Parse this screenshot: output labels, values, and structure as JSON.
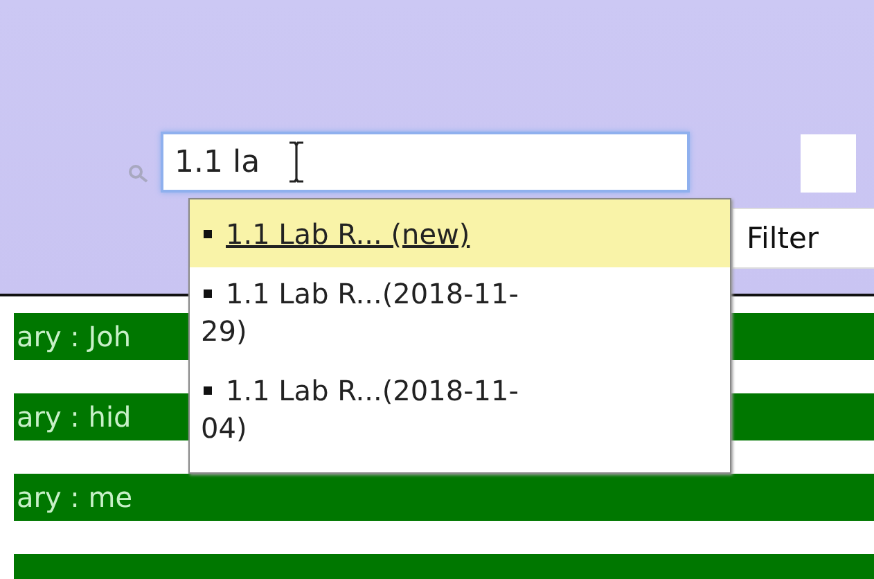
{
  "search": {
    "value": "1.1 la"
  },
  "suggestions": [
    {
      "label": "1.1 Lab R... (new)",
      "selected": true
    },
    {
      "label": "1.1 Lab R...(2018-11-29)",
      "selected": false
    },
    {
      "label": "1.1 Lab R...(2018-11-04)",
      "selected": false
    }
  ],
  "filter_button": "Filter",
  "rows": [
    {
      "label": "ary : Joh"
    },
    {
      "label": "ary : hid"
    },
    {
      "label": "ary : me"
    },
    {
      "label": ""
    }
  ]
}
